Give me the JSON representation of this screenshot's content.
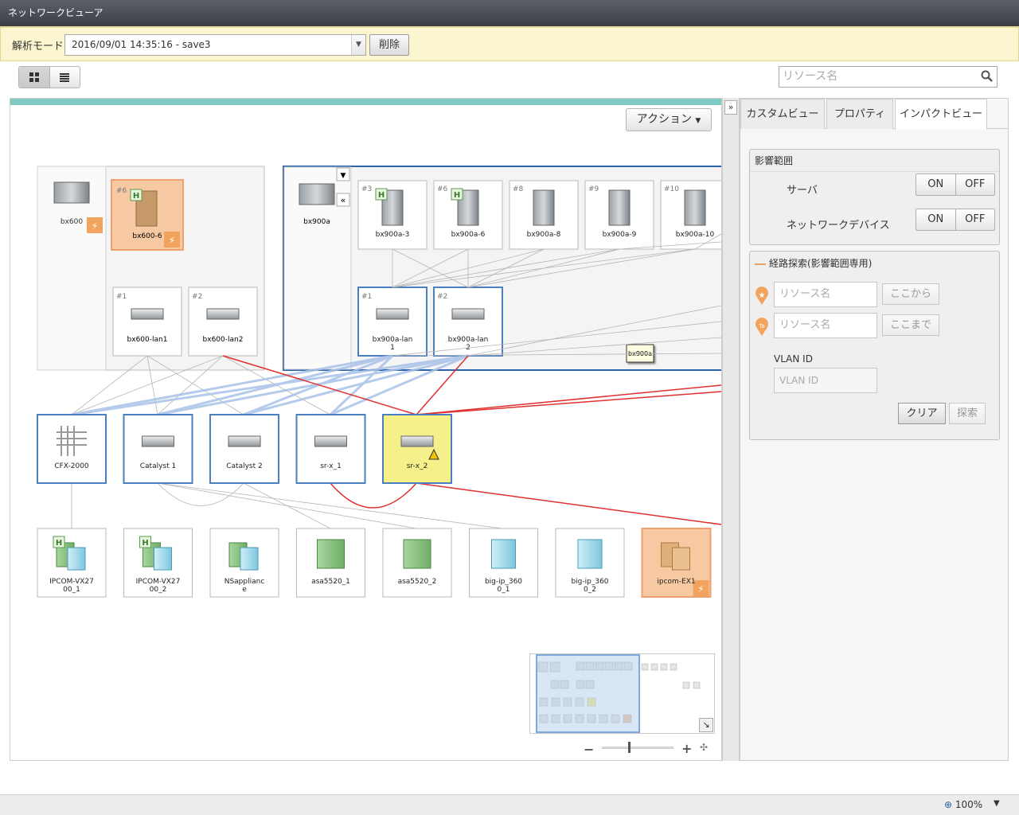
{
  "window": {
    "title": "ネットワークビューア"
  },
  "mode_bar": {
    "label": "解析モード",
    "selected_snapshot": "2016/09/01 14:35:16 - save3",
    "delete_label": "削除"
  },
  "search": {
    "placeholder": "リソース名"
  },
  "action_label": "アクション",
  "colors": {
    "selected_border": "#4a7fc1",
    "alert_bg": "#f6c9a3",
    "warn_bg": "#f5f08a",
    "link_red": "#e03030",
    "link_blue": "#8fb0e0"
  },
  "groups": {
    "bx600": {
      "chassis": "bx600",
      "blade_slot": "#6",
      "blade": "bx600-6",
      "lan1_slot": "#1",
      "lan1": "bx600-lan1",
      "lan2_slot": "#2",
      "lan2": "bx600-lan2"
    },
    "bx900a": {
      "chassis": "bx900a",
      "tooltip": "bx900a",
      "blades": [
        {
          "slot": "#3",
          "name": "bx900a-3",
          "h": true
        },
        {
          "slot": "#6",
          "name": "bx900a-6",
          "h": true
        },
        {
          "slot": "#8",
          "name": "bx900a-8",
          "h": false
        },
        {
          "slot": "#9",
          "name": "bx900a-9",
          "h": false
        },
        {
          "slot": "#10",
          "name": "bx900a-10",
          "h": false
        }
      ],
      "lans": [
        {
          "slot": "#1",
          "name": "bx900a-lan1"
        },
        {
          "slot": "#2",
          "name": "bx900a-lan2"
        }
      ]
    }
  },
  "switches": [
    "CFX-2000",
    "Catalyst 1",
    "Catalyst 2",
    "sr-x_1",
    "sr-x_2"
  ],
  "appliances": [
    "IPCOM-VX2700_1",
    "IPCOM-VX2700_2",
    "NSappliance",
    "asa5520_1",
    "asa5520_2",
    "big-ip_3600_1",
    "big-ip_3600_2",
    "ipcom-EX1"
  ],
  "right_panel": {
    "tabs": [
      "カスタムビュー",
      "プロパティ",
      "インパクトビュー"
    ],
    "impact_section": {
      "title": "影響範囲",
      "server_label": "サーバ",
      "network_label": "ネットワークデバイス",
      "on": "ON",
      "off": "OFF"
    },
    "route_section": {
      "title": "経路探索(影響範囲専用)",
      "from_placeholder": "リソース名",
      "from_button": "ここから",
      "to_placeholder": "リソース名",
      "to_button": "ここまで",
      "vlan_label": "VLAN ID",
      "vlan_placeholder": "VLAN ID",
      "clear": "クリア",
      "search": "探索"
    }
  },
  "status": {
    "zoom": "100%"
  }
}
